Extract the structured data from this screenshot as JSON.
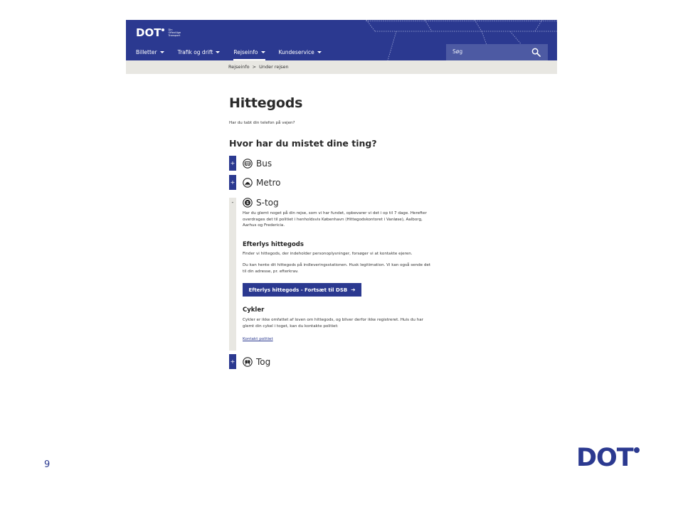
{
  "header": {
    "logo_text": "DOT",
    "logo_tagline": [
      "Din",
      "Offentlige",
      "Transport"
    ],
    "nav": [
      {
        "label": "Billetter"
      },
      {
        "label": "Trafik og drift"
      },
      {
        "label": "Rejseinfo",
        "active": true
      },
      {
        "label": "Kundeservice"
      }
    ],
    "search_placeholder": "Søg",
    "colors": {
      "brand": "#2b3990",
      "crumb_bg": "#e8e7e2"
    }
  },
  "breadcrumb": {
    "items": [
      "Rejseinfo",
      "Under rejsen"
    ],
    "separator": ">"
  },
  "main": {
    "title": "Hittegods",
    "intro": "Har du tabt din telefon på vejen?",
    "question": "Hvor har du mistet dine ting?",
    "accordion": [
      {
        "toggle": "+",
        "icon": "bus-icon",
        "label": "Bus",
        "open": false
      },
      {
        "toggle": "+",
        "icon": "metro-icon",
        "label": "Metro",
        "open": false
      },
      {
        "toggle": "-",
        "icon": "s-tog-icon",
        "label": "S-tog",
        "open": true
      },
      {
        "toggle": "+",
        "icon": "train-icon",
        "label": "Tog",
        "open": false
      }
    ],
    "stog_panel": {
      "intro_lines": [
        "Har du glemt noget på din rejse, som vi har fundet, opbevarer vi det i op til 7 dage. Herefter",
        "overdrages det til politiet i henholdsvis København (Hittegodskontoret i Vanløse), Aalborg,",
        "Aarhus og Fredericia."
      ],
      "heading1": "Efterlys hittegods",
      "p1": "Finder vi hittegods, der indeholder personoplysninger, forsøger vi at kontakte ejeren.",
      "p2_lines": [
        "Du kan hente dit hittegods på indleveringsstationen. Husk legitimation. Vi kan også sende det",
        "til din adresse, pr. efterkrav."
      ],
      "cta_label": "Efterlys hittegods - Fortsæt til DSB",
      "heading2": "Cykler",
      "p3_lines": [
        "Cykler er ikke omfattet af loven om hittegods, og bliver derfor ikke registreret. Huis du har",
        "glemt din cykel i toget, kan du kontakte politiet:"
      ],
      "link_label": "Kontakt politiet"
    }
  },
  "slide": {
    "number": "9",
    "brand_logo_text": "DOT"
  }
}
